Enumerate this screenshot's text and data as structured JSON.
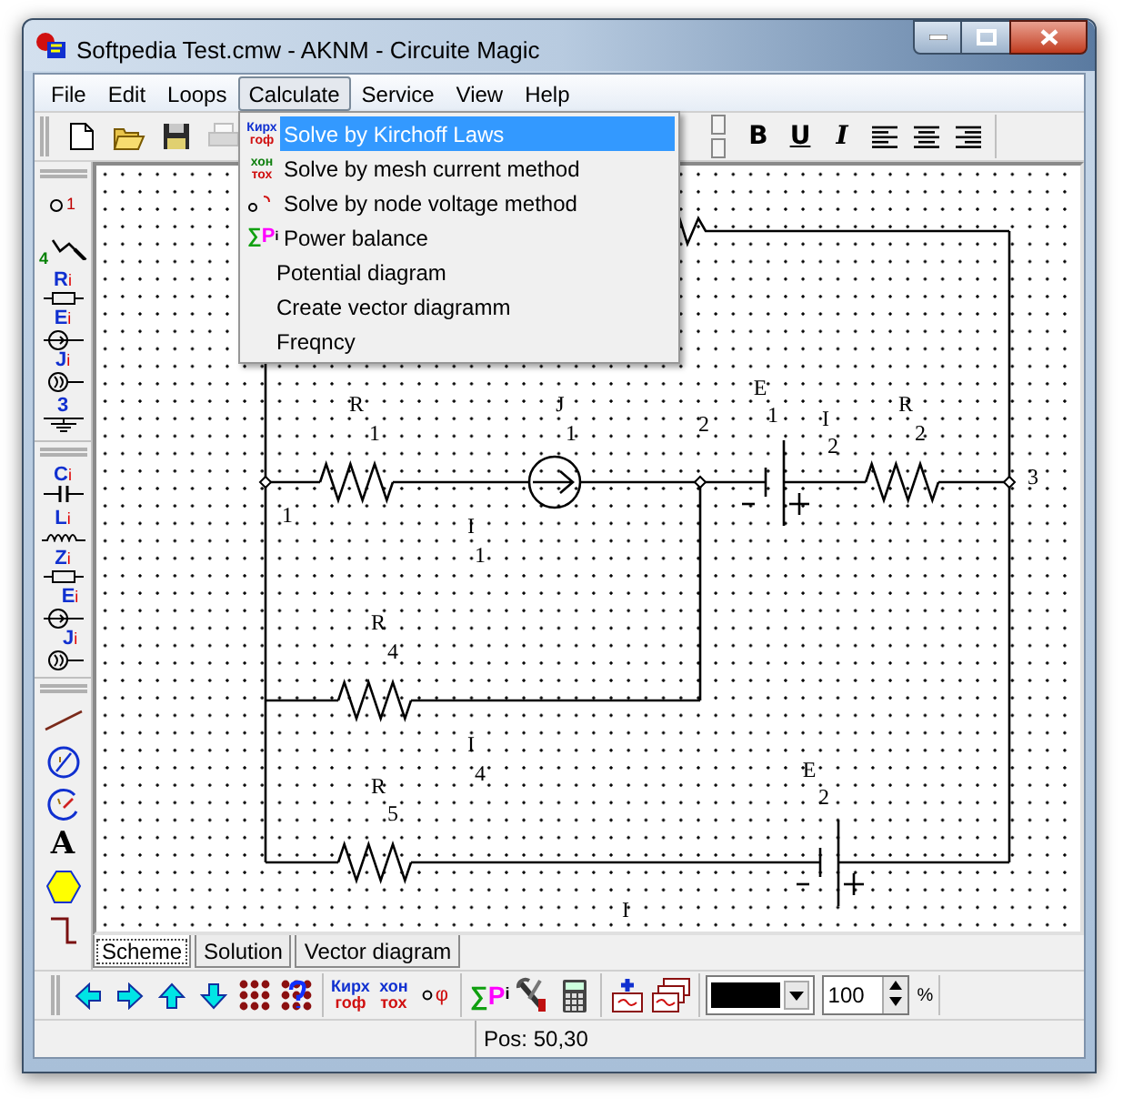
{
  "window": {
    "title": "Softpedia Test.cmw - AKNM - Circuite Magic"
  },
  "menu_bar": [
    {
      "label": "File",
      "selected": false
    },
    {
      "label": "Edit",
      "selected": false
    },
    {
      "label": "Loops",
      "selected": false
    },
    {
      "label": "Calculate",
      "selected": true
    },
    {
      "label": "Service",
      "selected": false
    },
    {
      "label": "View",
      "selected": false
    },
    {
      "label": "Help",
      "selected": false
    }
  ],
  "calculate_menu": [
    {
      "label": "Solve by Kirchoff Laws",
      "selected": true,
      "kind": "text",
      "icon_lines": [
        "Кирх",
        "гоф"
      ]
    },
    {
      "label": "Solve by mesh current method",
      "selected": false,
      "kind": "text",
      "icon_lines": [
        "хон",
        "тох"
      ]
    },
    {
      "label": "Solve by node voltage method",
      "selected": false,
      "kind": "node"
    },
    {
      "label": "Power balance",
      "selected": false,
      "kind": "power",
      "icon_parts": [
        "∑",
        "P",
        "i"
      ]
    },
    {
      "label": "Potential diagram",
      "selected": false,
      "kind": "plain"
    },
    {
      "label": "Create vector diagramm",
      "selected": false,
      "kind": "plain"
    },
    {
      "label": "Freqncy",
      "selected": false,
      "kind": "plain"
    }
  ],
  "top_toolbar": [
    {
      "kind": "new",
      "disabled": false
    },
    {
      "kind": "open",
      "disabled": false
    },
    {
      "kind": "save",
      "disabled": false
    },
    {
      "kind": "print",
      "disabled": true
    }
  ],
  "format_toolbar": [
    {
      "kind": "spin"
    },
    {
      "kind": "bold",
      "text": "B"
    },
    {
      "kind": "underline",
      "text": "U"
    },
    {
      "kind": "italic",
      "text": "I"
    },
    {
      "kind": "align-left"
    },
    {
      "kind": "align-center"
    },
    {
      "kind": "align-right"
    }
  ],
  "left_toolbar": [
    [
      {
        "kind": "node",
        "sub": "1"
      },
      {
        "kind": "wire",
        "sub": "4"
      },
      {
        "kind": "resistor",
        "text": "R",
        "sub": "i"
      },
      {
        "kind": "emf",
        "text": "E",
        "sub": "i"
      },
      {
        "kind": "current-source",
        "text": "J",
        "sub": "i"
      },
      {
        "kind": "ground",
        "text": "3"
      }
    ],
    [
      {
        "kind": "capacitor",
        "text": "C",
        "sub": "i"
      },
      {
        "kind": "inductor",
        "text": "L",
        "sub": "i"
      },
      {
        "kind": "impedance",
        "text": "Z",
        "sub": "i"
      },
      {
        "kind": "ac-emf",
        "text": "E",
        "sub": "i"
      },
      {
        "kind": "ac-current",
        "text": "J",
        "sub": "i"
      }
    ],
    [
      {
        "kind": "line"
      },
      {
        "kind": "meter"
      },
      {
        "kind": "meter-open"
      },
      {
        "kind": "text-tool",
        "text": "A"
      },
      {
        "kind": "polygon"
      },
      {
        "kind": "step"
      }
    ]
  ],
  "canvas_labels": [
    {
      "text": "R",
      "sub": "1"
    },
    {
      "text": "J",
      "sub": "1"
    },
    {
      "text": "2"
    },
    {
      "text": "E",
      "sub": "1"
    },
    {
      "text": "I",
      "sub": "2"
    },
    {
      "text": "R",
      "sub": "2"
    },
    {
      "text": "3"
    },
    {
      "text": "1"
    },
    {
      "text": "I",
      "sub": "1"
    },
    {
      "text": "R",
      "sub": "4"
    },
    {
      "text": "I",
      "sub": "4"
    },
    {
      "text": "R",
      "sub": "5"
    },
    {
      "text": "E",
      "sub": "2"
    },
    {
      "text": "I"
    }
  ],
  "tabs": [
    {
      "label": "Scheme",
      "selected": true
    },
    {
      "label": "Solution",
      "selected": false
    },
    {
      "label": "Vector diagram",
      "selected": false
    }
  ],
  "bottom_toolbar": [
    [
      {
        "kind": "arrow-left"
      },
      {
        "kind": "arrow-right"
      },
      {
        "kind": "arrow-up"
      },
      {
        "kind": "arrow-down"
      },
      {
        "kind": "dot-grid"
      },
      {
        "kind": "dot-grid-help"
      }
    ],
    [
      {
        "kind": "text-icon",
        "lines": [
          "Кирх",
          "гоф"
        ]
      },
      {
        "kind": "text-icon",
        "lines": [
          "хон",
          "тох"
        ]
      },
      {
        "kind": "potential",
        "text": "φ"
      }
    ],
    [
      {
        "kind": "power",
        "parts": [
          "∑",
          "P",
          "i"
        ]
      },
      {
        "kind": "tools"
      },
      {
        "kind": "calculator"
      }
    ],
    [
      {
        "kind": "add-sheet"
      },
      {
        "kind": "sheets"
      }
    ],
    [
      {
        "kind": "color",
        "color": "#000000"
      },
      {
        "kind": "spin",
        "value": "100"
      },
      {
        "kind": "unit",
        "text": "%"
      }
    ]
  ],
  "status_bar": {
    "position": "Pos: 50,30"
  }
}
